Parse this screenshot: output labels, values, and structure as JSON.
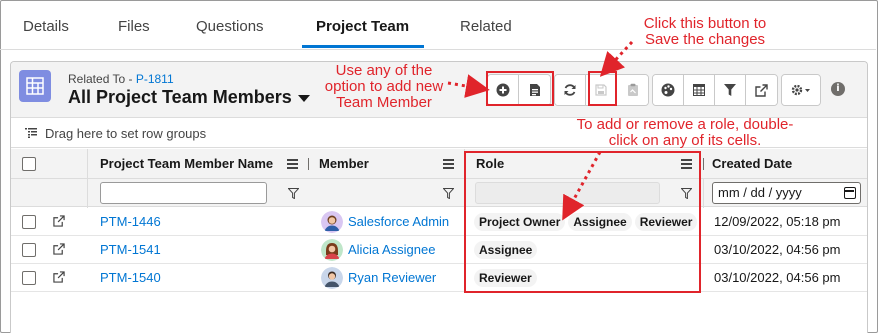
{
  "tabs": [
    {
      "label": "Details",
      "active": false
    },
    {
      "label": "Files",
      "active": false
    },
    {
      "label": "Questions",
      "active": false
    },
    {
      "label": "Project Team",
      "active": true
    },
    {
      "label": "Related",
      "active": false
    }
  ],
  "header": {
    "related_prefix": "Related To - ",
    "related_link": "P-1811",
    "list_title": "All Project Team Members"
  },
  "toolbar": {
    "icons": [
      "add-icon",
      "new-record-icon",
      "refresh-icon",
      "save-icon",
      "clipboard-icon",
      "palette-icon",
      "table-icon",
      "filter-icon",
      "popout-icon",
      "gear-icon",
      "info-icon"
    ]
  },
  "group_bar": {
    "text": "Drag here to set row groups"
  },
  "columns": {
    "name": "Project Team Member Name",
    "member": "Member",
    "role": "Role",
    "created": "Created Date"
  },
  "filters": {
    "created_placeholder": "mm / dd / yyyy"
  },
  "rows": [
    {
      "name": "PTM-1446",
      "member": "Salesforce Admin",
      "roles": [
        "Project Owner",
        "Assignee",
        "Reviewer"
      ],
      "created": "12/09/2022, 05:18 pm"
    },
    {
      "name": "PTM-1541",
      "member": "Alicia Assignee",
      "roles": [
        "Assignee"
      ],
      "created": "03/10/2022, 04:56 pm"
    },
    {
      "name": "PTM-1540",
      "member": "Ryan Reviewer",
      "roles": [
        "Reviewer"
      ],
      "created": "03/10/2022, 04:56 pm"
    }
  ],
  "annotations": {
    "save_note": "Click this button to\nSave the changes",
    "add_note": "Use any of the\noption to add new\nTeam Member",
    "role_note": "To add or remove a role, double-\nclick on any of its cells."
  },
  "colors": {
    "accent": "#0176d3",
    "annotation": "#e0242b",
    "object_icon": "#7f8de1"
  }
}
